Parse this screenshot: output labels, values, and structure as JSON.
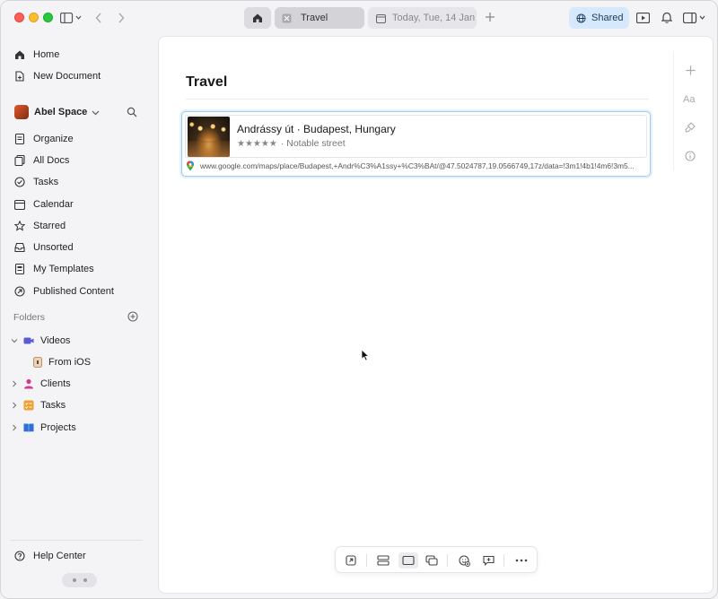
{
  "titlebar": {
    "tabs": [
      {
        "label": "",
        "icon": "home-icon"
      },
      {
        "label": "Travel",
        "icon": "doc-tab-icon"
      },
      {
        "label": "Today, Tue, 14 Jan",
        "icon": "calendar-icon"
      }
    ],
    "shared_label": "Shared"
  },
  "sidebar": {
    "top_items": [
      {
        "label": "Home",
        "icon": "home-icon"
      },
      {
        "label": "New Document",
        "icon": "new-document-icon"
      }
    ],
    "space_name": "Abel Space",
    "items": [
      {
        "label": "Organize",
        "icon": "organize-icon"
      },
      {
        "label": "All Docs",
        "icon": "docs-icon"
      },
      {
        "label": "Tasks",
        "icon": "check-circle-icon"
      },
      {
        "label": "Calendar",
        "icon": "calendar-icon"
      },
      {
        "label": "Starred",
        "icon": "star-icon"
      },
      {
        "label": "Unsorted",
        "icon": "inbox-icon"
      },
      {
        "label": "My Templates",
        "icon": "template-icon"
      },
      {
        "label": "Published Content",
        "icon": "published-icon"
      }
    ],
    "folders_label": "Folders",
    "folders": [
      {
        "label": "Videos",
        "color": "#5b5bd6",
        "expanded": true
      },
      {
        "label": "From iOS",
        "color": "#b07b4a",
        "child": true
      },
      {
        "label": "Clients",
        "color": "#d6398c"
      },
      {
        "label": "Tasks",
        "color": "#f0a030"
      },
      {
        "label": "Projects",
        "color": "#2f6fd6"
      }
    ],
    "help_label": "Help Center"
  },
  "document": {
    "title": "Travel",
    "link": {
      "title": "Andrássy út · Budapest, Hungary",
      "stars": "★★★★★",
      "category": "· Notable street",
      "url": "www.google.com/maps/place/Budapest,+Andr%C3%A1ssy+%C3%BAt/@47.5024787,19.0566749,17z/data=!3m1!4b1!4m6!3m5..."
    }
  },
  "colors": {
    "accent": "#d6e8fb",
    "link_border": "#9fcdf0"
  }
}
